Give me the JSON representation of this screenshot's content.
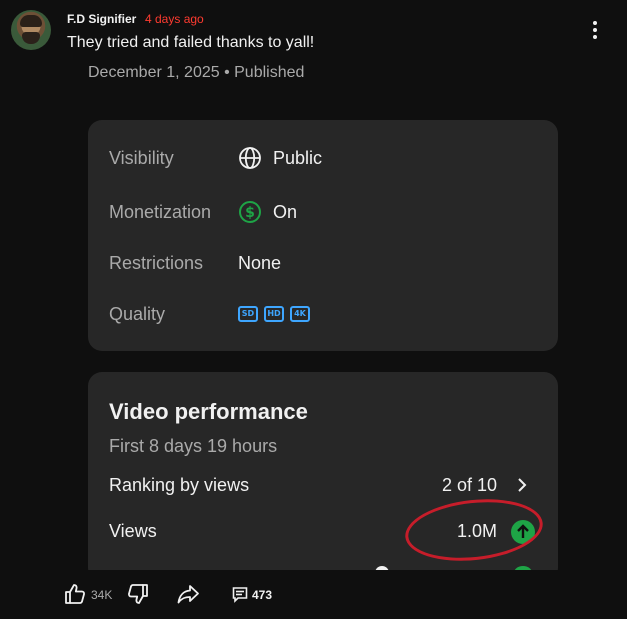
{
  "post": {
    "author": "F.D Signifier",
    "time": "4 days ago",
    "comment": "They tried and failed thanks to yall!",
    "meta": "December 1, 2025 • Published"
  },
  "details": {
    "rows": [
      {
        "label": "Visibility",
        "value": "Public",
        "icon": "globe-icon"
      },
      {
        "label": "Monetization",
        "value": "On",
        "icon": "dollar-circle-icon"
      },
      {
        "label": "Restrictions",
        "value": "None"
      },
      {
        "label": "Quality",
        "badges": [
          "SD",
          "HD",
          "4K"
        ]
      }
    ]
  },
  "performance": {
    "title": "Video performance",
    "subtitle": "First 8 days 19 hours",
    "rows": [
      {
        "label": "Ranking by views",
        "value": "2 of 10",
        "icon": "chevron-right-icon"
      },
      {
        "label": "Views",
        "value": "1.0M",
        "icon": "arrow-up-circle-icon"
      }
    ]
  },
  "actions": {
    "likes": "34K",
    "comments": "473"
  },
  "colors": {
    "background": "#0f0f0f",
    "card": "#272727",
    "accent_green": "#1ea446",
    "badge_blue": "#3ea6ff",
    "time_red": "#ff3b30",
    "annotation_red": "#c61d2a"
  }
}
